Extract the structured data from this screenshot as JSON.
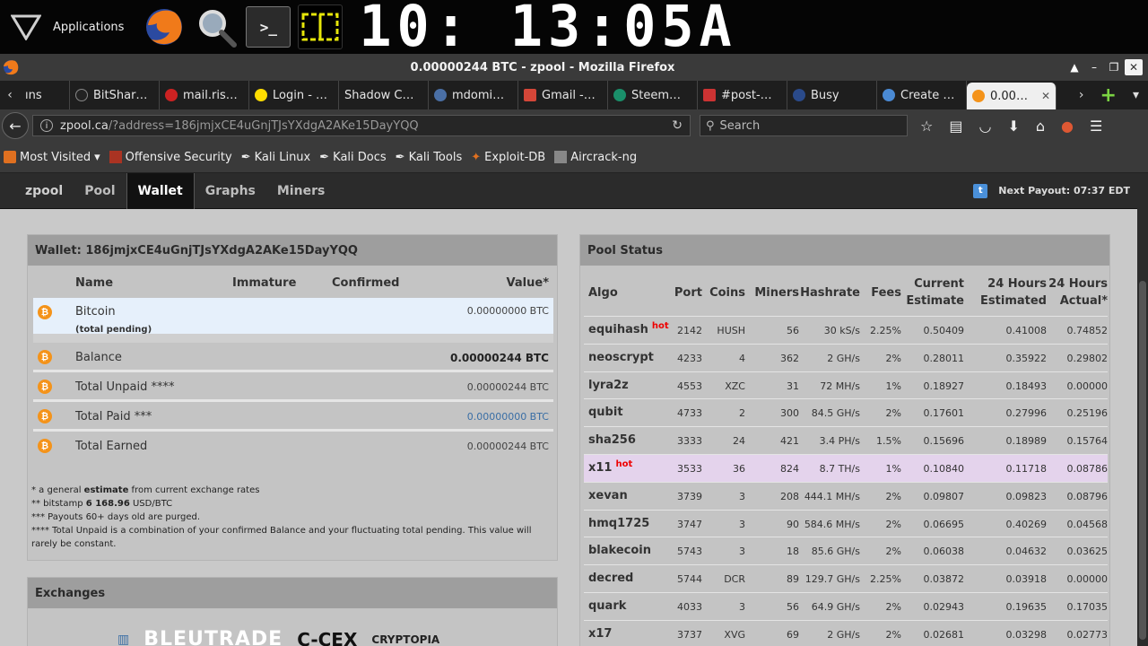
{
  "desktop_panel": {
    "apps_label": "Applications",
    "terminal_glyph": ">_",
    "clock": "10: 13:05A"
  },
  "window": {
    "title": "0.00000244 BTC - zpool - Mozilla Firefox",
    "controls": [
      "▲",
      "–",
      "❐",
      "✕"
    ]
  },
  "tabs": [
    {
      "label": "ıns",
      "icon_color": "#555555"
    },
    {
      "label": "BitShar…",
      "icon_color": "#222222"
    },
    {
      "label": "mail.ris…",
      "icon_color": "#cc2222"
    },
    {
      "label": "Login - …",
      "icon_color": "#ffdd00"
    },
    {
      "label": "Shadow C…",
      "icon_color": "#1e1e1e"
    },
    {
      "label": "mdomi…",
      "icon_color": "#4a6fa5"
    },
    {
      "label": "Gmail -…",
      "icon_color": "#d44638"
    },
    {
      "label": "Steem…",
      "icon_color": "#1a8f6a"
    },
    {
      "label": "#post-…",
      "icon_color": "#cc3333"
    },
    {
      "label": "Busy",
      "icon_color": "#2a4a8a"
    },
    {
      "label": "Create …",
      "icon_color": "#4a8ad4"
    },
    {
      "label": "0.00…",
      "icon_color": "#f4931a",
      "active": true
    }
  ],
  "navbar": {
    "url_host": "zpool.ca",
    "url_path": "/?address=186jmjxCE4uGnjTJsYXdgA2AKe15DayYQQ",
    "search_placeholder": "Search"
  },
  "bookmarks": [
    {
      "label": "Most Visited",
      "icon_color": "#e07020"
    },
    {
      "label": "Offensive Security",
      "icon_color": "#aa3322"
    },
    {
      "label": "Kali Linux",
      "icon_color": "#dddddd"
    },
    {
      "label": "Kali Docs",
      "icon_color": "#dddddd"
    },
    {
      "label": "Kali Tools",
      "icon_color": "#dddddd"
    },
    {
      "label": "Exploit-DB",
      "icon_color": "#e07020"
    },
    {
      "label": "Aircrack-ng",
      "icon_color": "#888888"
    }
  ],
  "site_nav": {
    "brand": "zpool",
    "items": [
      "Pool",
      "Wallet",
      "Graphs",
      "Miners"
    ],
    "active": "Wallet",
    "next_payout": "Next Payout: 07:37 EDT"
  },
  "wallet": {
    "title": "Wallet: 186jmjxCE4uGnjTJsYXdgA2AKe15DayYQQ",
    "headers": {
      "name": "Name",
      "immature": "Immature",
      "confirmed": "Confirmed",
      "value": "Value*"
    },
    "pending": {
      "name": "Bitcoin",
      "sub": "(total pending)",
      "value": "0.00000000 BTC"
    },
    "balance": {
      "name": "Balance",
      "value": "0.00000244 BTC"
    },
    "unpaid": {
      "name": "Total Unpaid ****",
      "value": "0.00000244 BTC"
    },
    "paid": {
      "name": "Total Paid ***",
      "value": "0.00000000 BTC"
    },
    "earned": {
      "name": "Total Earned",
      "value": "0.00000244 BTC"
    },
    "notes": {
      "n1a": "* a general ",
      "n1b": "estimate",
      "n1c": " from current exchange rates",
      "n2a": "** bitstamp ",
      "n2b": "6 168.96",
      "n2c": " USD/BTC",
      "n3": "*** Payouts 60+ days old are purged.",
      "n4": "**** Total Unpaid is a combination of your confirmed Balance and your fluctuating total pending. This value will rarely be constant."
    }
  },
  "exchanges": {
    "title": "Exchanges",
    "logos": [
      "BLEUTRADE",
      "C-CEX",
      "CRYPTOPIA"
    ]
  },
  "pool_status": {
    "title": "Pool Status",
    "headers": {
      "algo": "Algo",
      "port": "Port",
      "coins": "Coins",
      "miners": "Miners",
      "hashrate": "Hashrate",
      "fees": "Fees",
      "cur1": "Current",
      "cur2": "Estimate",
      "e1": "24 Hours",
      "e2": "Estimated",
      "a1": "24 Hours",
      "a2": "Actual*"
    },
    "rows": [
      {
        "algo": "equihash",
        "hot": "hot",
        "port": "2142",
        "coins": "HUSH",
        "miners": "56",
        "hashrate": "30 kS/s",
        "fees": "2.25%",
        "current": "0.50409",
        "est24": "0.41008",
        "act24": "0.74852"
      },
      {
        "algo": "neoscrypt",
        "hot": "",
        "port": "4233",
        "coins": "4",
        "miners": "362",
        "hashrate": "2 GH/s",
        "fees": "2%",
        "current": "0.28011",
        "est24": "0.35922",
        "act24": "0.29802"
      },
      {
        "algo": "lyra2z",
        "hot": "",
        "port": "4553",
        "coins": "XZC",
        "miners": "31",
        "hashrate": "72 MH/s",
        "fees": "1%",
        "current": "0.18927",
        "est24": "0.18493",
        "act24": "0.00000"
      },
      {
        "algo": "qubit",
        "hot": "",
        "port": "4733",
        "coins": "2",
        "miners": "300",
        "hashrate": "84.5 GH/s",
        "fees": "2%",
        "current": "0.17601",
        "est24": "0.27996",
        "act24": "0.25196"
      },
      {
        "algo": "sha256",
        "hot": "",
        "port": "3333",
        "coins": "24",
        "miners": "421",
        "hashrate": "3.4 PH/s",
        "fees": "1.5%",
        "current": "0.15696",
        "est24": "0.18989",
        "act24": "0.15764"
      },
      {
        "algo": "x11",
        "hot": "hot",
        "port": "3533",
        "coins": "36",
        "miners": "824",
        "hashrate": "8.7 TH/s",
        "fees": "1%",
        "current": "0.10840",
        "est24": "0.11718",
        "act24": "0.08786",
        "highlight": true
      },
      {
        "algo": "xevan",
        "hot": "",
        "port": "3739",
        "coins": "3",
        "miners": "208",
        "hashrate": "444.1 MH/s",
        "fees": "2%",
        "current": "0.09807",
        "est24": "0.09823",
        "act24": "0.08796"
      },
      {
        "algo": "hmq1725",
        "hot": "",
        "port": "3747",
        "coins": "3",
        "miners": "90",
        "hashrate": "584.6 MH/s",
        "fees": "2%",
        "current": "0.06695",
        "est24": "0.40269",
        "act24": "0.04568"
      },
      {
        "algo": "blakecoin",
        "hot": "",
        "port": "5743",
        "coins": "3",
        "miners": "18",
        "hashrate": "85.6 GH/s",
        "fees": "2%",
        "current": "0.06038",
        "est24": "0.04632",
        "act24": "0.03625"
      },
      {
        "algo": "decred",
        "hot": "",
        "port": "5744",
        "coins": "DCR",
        "miners": "89",
        "hashrate": "129.7 GH/s",
        "fees": "2.25%",
        "current": "0.03872",
        "est24": "0.03918",
        "act24": "0.00000"
      },
      {
        "algo": "quark",
        "hot": "",
        "port": "4033",
        "coins": "3",
        "miners": "56",
        "hashrate": "64.9 GH/s",
        "fees": "2%",
        "current": "0.02943",
        "est24": "0.19635",
        "act24": "0.17035"
      },
      {
        "algo": "x17",
        "hot": "",
        "port": "3737",
        "coins": "XVG",
        "miners": "69",
        "hashrate": "2 GH/s",
        "fees": "2%",
        "current": "0.02681",
        "est24": "0.03298",
        "act24": "0.02773"
      }
    ]
  },
  "colors": {
    "bitcoin": "#f4931a",
    "hot": "#ee0000",
    "highlight_row": "#e4d3ec",
    "pending_row": "#e6f0fb",
    "link_blue": "#3a6ea5"
  }
}
